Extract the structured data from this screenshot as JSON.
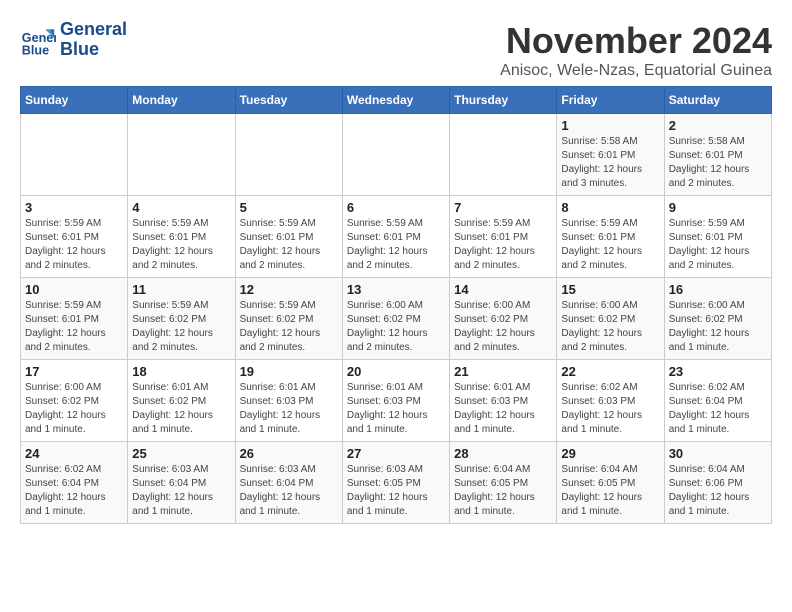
{
  "logo": {
    "line1": "General",
    "line2": "Blue"
  },
  "title": "November 2024",
  "subtitle": "Anisoc, Wele-Nzas, Equatorial Guinea",
  "header_color": "#3a6fba",
  "days_of_week": [
    "Sunday",
    "Monday",
    "Tuesday",
    "Wednesday",
    "Thursday",
    "Friday",
    "Saturday"
  ],
  "weeks": [
    [
      {
        "day": "",
        "info": ""
      },
      {
        "day": "",
        "info": ""
      },
      {
        "day": "",
        "info": ""
      },
      {
        "day": "",
        "info": ""
      },
      {
        "day": "",
        "info": ""
      },
      {
        "day": "1",
        "info": "Sunrise: 5:58 AM\nSunset: 6:01 PM\nDaylight: 12 hours and 3 minutes."
      },
      {
        "day": "2",
        "info": "Sunrise: 5:58 AM\nSunset: 6:01 PM\nDaylight: 12 hours and 2 minutes."
      }
    ],
    [
      {
        "day": "3",
        "info": "Sunrise: 5:59 AM\nSunset: 6:01 PM\nDaylight: 12 hours and 2 minutes."
      },
      {
        "day": "4",
        "info": "Sunrise: 5:59 AM\nSunset: 6:01 PM\nDaylight: 12 hours and 2 minutes."
      },
      {
        "day": "5",
        "info": "Sunrise: 5:59 AM\nSunset: 6:01 PM\nDaylight: 12 hours and 2 minutes."
      },
      {
        "day": "6",
        "info": "Sunrise: 5:59 AM\nSunset: 6:01 PM\nDaylight: 12 hours and 2 minutes."
      },
      {
        "day": "7",
        "info": "Sunrise: 5:59 AM\nSunset: 6:01 PM\nDaylight: 12 hours and 2 minutes."
      },
      {
        "day": "8",
        "info": "Sunrise: 5:59 AM\nSunset: 6:01 PM\nDaylight: 12 hours and 2 minutes."
      },
      {
        "day": "9",
        "info": "Sunrise: 5:59 AM\nSunset: 6:01 PM\nDaylight: 12 hours and 2 minutes."
      }
    ],
    [
      {
        "day": "10",
        "info": "Sunrise: 5:59 AM\nSunset: 6:01 PM\nDaylight: 12 hours and 2 minutes."
      },
      {
        "day": "11",
        "info": "Sunrise: 5:59 AM\nSunset: 6:02 PM\nDaylight: 12 hours and 2 minutes."
      },
      {
        "day": "12",
        "info": "Sunrise: 5:59 AM\nSunset: 6:02 PM\nDaylight: 12 hours and 2 minutes."
      },
      {
        "day": "13",
        "info": "Sunrise: 6:00 AM\nSunset: 6:02 PM\nDaylight: 12 hours and 2 minutes."
      },
      {
        "day": "14",
        "info": "Sunrise: 6:00 AM\nSunset: 6:02 PM\nDaylight: 12 hours and 2 minutes."
      },
      {
        "day": "15",
        "info": "Sunrise: 6:00 AM\nSunset: 6:02 PM\nDaylight: 12 hours and 2 minutes."
      },
      {
        "day": "16",
        "info": "Sunrise: 6:00 AM\nSunset: 6:02 PM\nDaylight: 12 hours and 1 minute."
      }
    ],
    [
      {
        "day": "17",
        "info": "Sunrise: 6:00 AM\nSunset: 6:02 PM\nDaylight: 12 hours and 1 minute."
      },
      {
        "day": "18",
        "info": "Sunrise: 6:01 AM\nSunset: 6:02 PM\nDaylight: 12 hours and 1 minute."
      },
      {
        "day": "19",
        "info": "Sunrise: 6:01 AM\nSunset: 6:03 PM\nDaylight: 12 hours and 1 minute."
      },
      {
        "day": "20",
        "info": "Sunrise: 6:01 AM\nSunset: 6:03 PM\nDaylight: 12 hours and 1 minute."
      },
      {
        "day": "21",
        "info": "Sunrise: 6:01 AM\nSunset: 6:03 PM\nDaylight: 12 hours and 1 minute."
      },
      {
        "day": "22",
        "info": "Sunrise: 6:02 AM\nSunset: 6:03 PM\nDaylight: 12 hours and 1 minute."
      },
      {
        "day": "23",
        "info": "Sunrise: 6:02 AM\nSunset: 6:04 PM\nDaylight: 12 hours and 1 minute."
      }
    ],
    [
      {
        "day": "24",
        "info": "Sunrise: 6:02 AM\nSunset: 6:04 PM\nDaylight: 12 hours and 1 minute."
      },
      {
        "day": "25",
        "info": "Sunrise: 6:03 AM\nSunset: 6:04 PM\nDaylight: 12 hours and 1 minute."
      },
      {
        "day": "26",
        "info": "Sunrise: 6:03 AM\nSunset: 6:04 PM\nDaylight: 12 hours and 1 minute."
      },
      {
        "day": "27",
        "info": "Sunrise: 6:03 AM\nSunset: 6:05 PM\nDaylight: 12 hours and 1 minute."
      },
      {
        "day": "28",
        "info": "Sunrise: 6:04 AM\nSunset: 6:05 PM\nDaylight: 12 hours and 1 minute."
      },
      {
        "day": "29",
        "info": "Sunrise: 6:04 AM\nSunset: 6:05 PM\nDaylight: 12 hours and 1 minute."
      },
      {
        "day": "30",
        "info": "Sunrise: 6:04 AM\nSunset: 6:06 PM\nDaylight: 12 hours and 1 minute."
      }
    ]
  ]
}
